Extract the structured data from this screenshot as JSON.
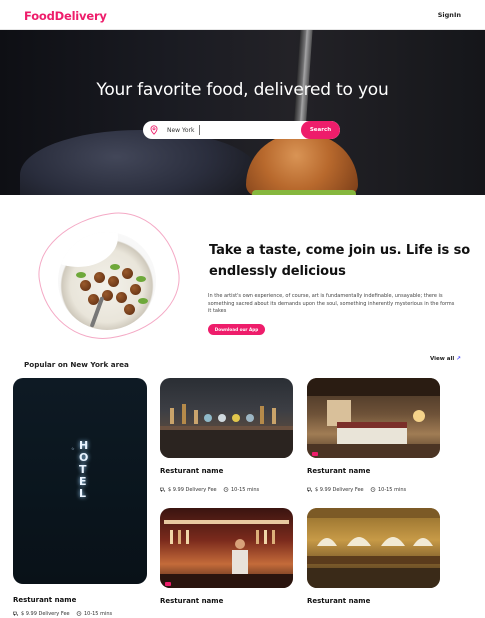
{
  "header": {
    "brand": "FoodDelivery",
    "signin_label": "SignIn"
  },
  "hero": {
    "title": "Your favorite food, delivered to you",
    "search": {
      "value": "New York",
      "button_label": "Search",
      "icon": "location-pin-icon"
    }
  },
  "promo": {
    "title": "Take a taste, come join us. Life is so endlessly delicious",
    "text": "In the artist's own experience, of course, art is fundamentally indefinable, unsayable; there is something sacred about its demands upon the soul, something inherently mysterious in the forms it takes",
    "button_label": "Download our App"
  },
  "popular": {
    "title": "Popular on New York area",
    "view_all_label": "View all",
    "view_all_icon": "arrow-up-right-icon",
    "cards": [
      {
        "name": "Resturant name",
        "fee": "$ 9.99 Delivery Fee",
        "time": "10-15 mins",
        "image": "hotel-sign"
      },
      {
        "name": "Resturant name",
        "fee": "$ 9.99 Delivery Fee",
        "time": "10-15 mins",
        "image": "bar"
      },
      {
        "name": "Resturant name",
        "fee": "$ 9.99 Delivery Fee",
        "time": "10-15 mins",
        "image": "hotel-room"
      },
      {
        "name": "Resturant name",
        "fee": "",
        "time": "",
        "image": "bar-with-bartender"
      },
      {
        "name": "Resturant name",
        "fee": "",
        "time": "",
        "image": "dining-hall"
      }
    ]
  },
  "colors": {
    "accent": "#ee1d6b",
    "text": "#111111"
  }
}
